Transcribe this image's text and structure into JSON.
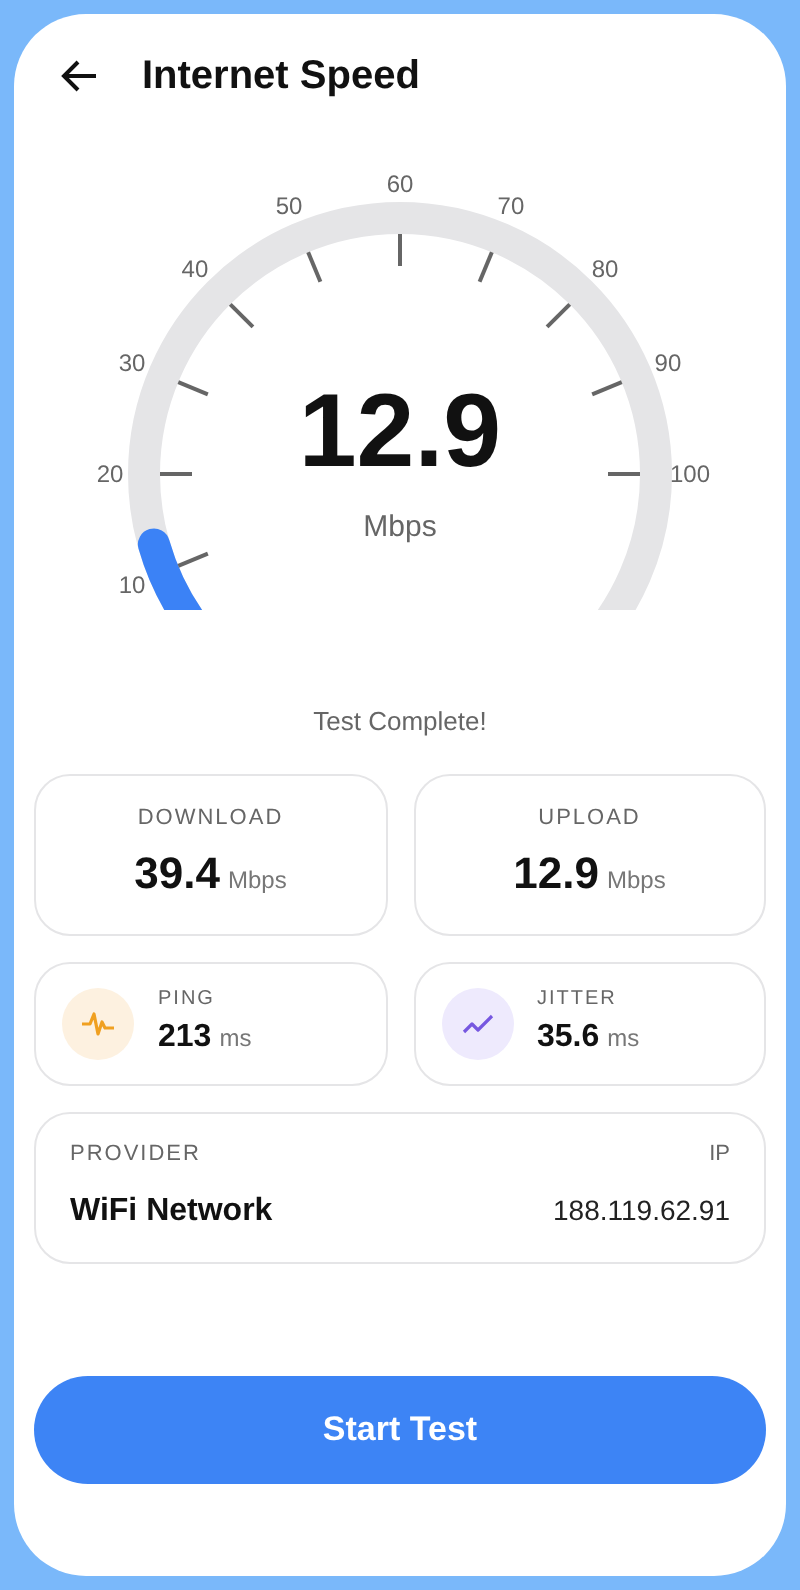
{
  "header": {
    "title": "Internet Speed"
  },
  "gauge": {
    "ticks": [
      "10",
      "20",
      "30",
      "40",
      "50",
      "60",
      "70",
      "80",
      "90",
      "100"
    ],
    "value": "12.9",
    "unit": "Mbps"
  },
  "status": "Test Complete!",
  "speeds": [
    {
      "label": "DOWNLOAD",
      "value": "39.4",
      "unit": "Mbps"
    },
    {
      "label": "UPLOAD",
      "value": "12.9",
      "unit": "Mbps"
    }
  ],
  "metrics": [
    {
      "kind": "ping",
      "label": "PING",
      "value": "213",
      "unit": "ms"
    },
    {
      "kind": "jitter",
      "label": "JITTER",
      "value": "35.6",
      "unit": "ms"
    }
  ],
  "provider": {
    "label": "PROVIDER",
    "name": "WiFi Network",
    "ip_label": "IP",
    "ip": "188.119.62.91"
  },
  "button": "Start Test"
}
